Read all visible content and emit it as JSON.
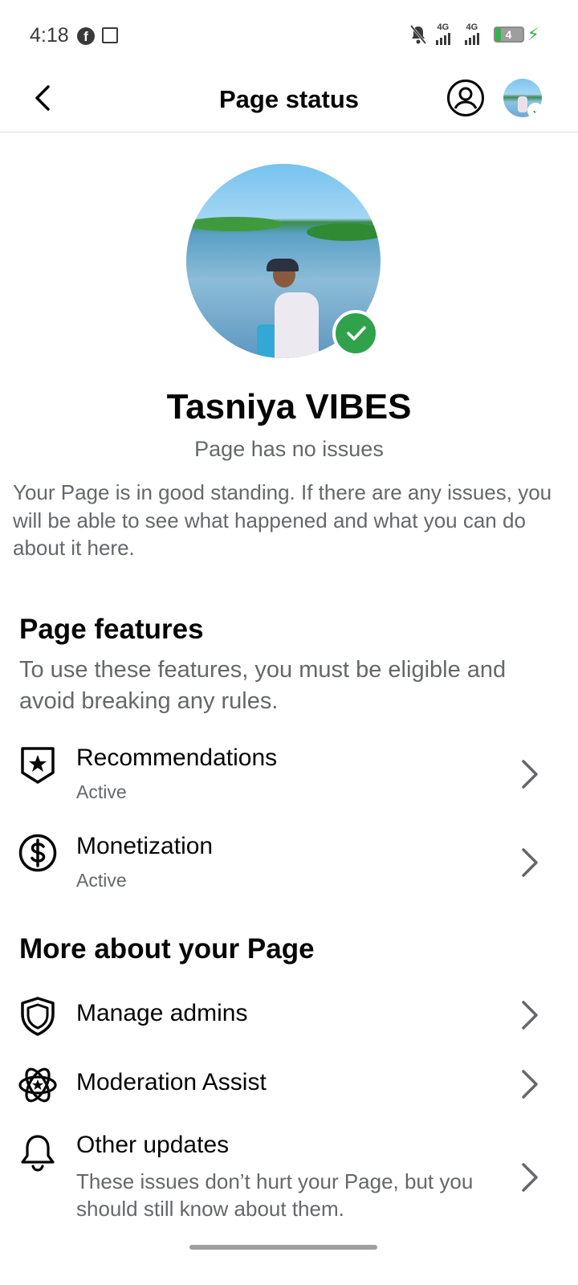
{
  "status_bar": {
    "time": "4:18",
    "network_1": "4G",
    "network_2": "4G",
    "battery": "4"
  },
  "header": {
    "title": "Page status"
  },
  "page": {
    "name": "Tasniya VIBES",
    "status": "Page has no issues",
    "description": "Your Page is in good standing. If there are any issues, you will be able to see what happened and what you can do about it here."
  },
  "features": {
    "title": "Page features",
    "description": "To use these features, you must be eligible and avoid breaking any rules.",
    "items": [
      {
        "label": "Recommendations",
        "status": "Active",
        "icon": "shield-star-icon"
      },
      {
        "label": "Monetization",
        "status": "Active",
        "icon": "dollar-circle-icon"
      }
    ]
  },
  "more": {
    "title": "More about your Page",
    "items": [
      {
        "label": "Manage admins",
        "icon": "shield-icon"
      },
      {
        "label": "Moderation Assist",
        "icon": "atom-star-icon"
      },
      {
        "label": "Other updates",
        "description": "These issues don’t hurt your Page, but you should still know about them.",
        "icon": "bell-icon"
      }
    ]
  },
  "colors": {
    "accent_green": "#31a24c",
    "secondary_text": "#65676b",
    "primary_text": "#050505"
  }
}
